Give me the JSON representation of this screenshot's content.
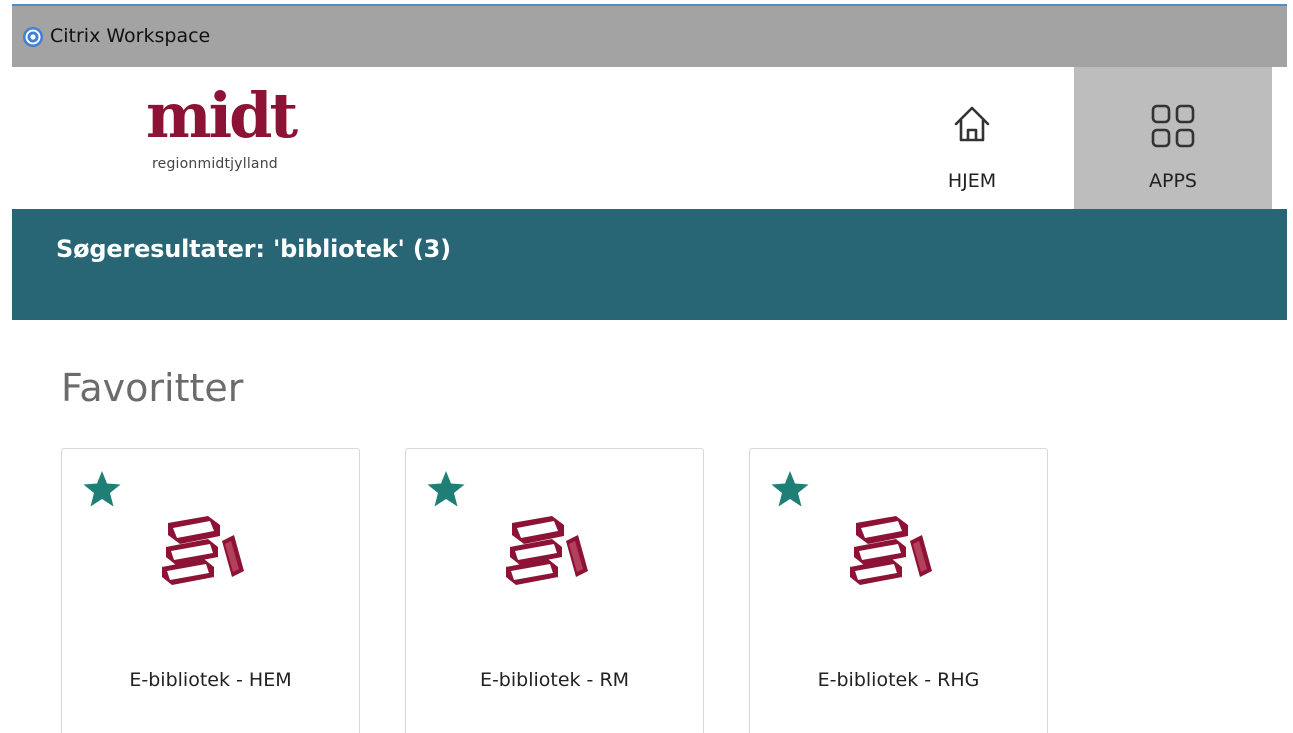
{
  "window": {
    "title": "Citrix Workspace",
    "icon": "citrix-icon"
  },
  "header": {
    "logo": {
      "wordmark": "midt",
      "subtitle": "regionmidtjylland",
      "color": "#8c1236"
    },
    "nav": [
      {
        "label": "HJEM",
        "icon": "home-icon",
        "active": false
      },
      {
        "label": "APPS",
        "icon": "apps-grid-icon",
        "active": true
      }
    ]
  },
  "search_banner": {
    "title": "Søgeresultater: 'bibliotek' (3)",
    "color": "#286575"
  },
  "favorites": {
    "section_title": "Favoritter",
    "star_color": "#1f7f76",
    "apps": [
      {
        "name": "E-bibliotek - HEM",
        "icon": "books-icon",
        "favorite": true
      },
      {
        "name": "E-bibliotek - RM",
        "icon": "books-icon",
        "favorite": true
      },
      {
        "name": "E-bibliotek - RHG",
        "icon": "books-icon",
        "favorite": true
      }
    ]
  }
}
